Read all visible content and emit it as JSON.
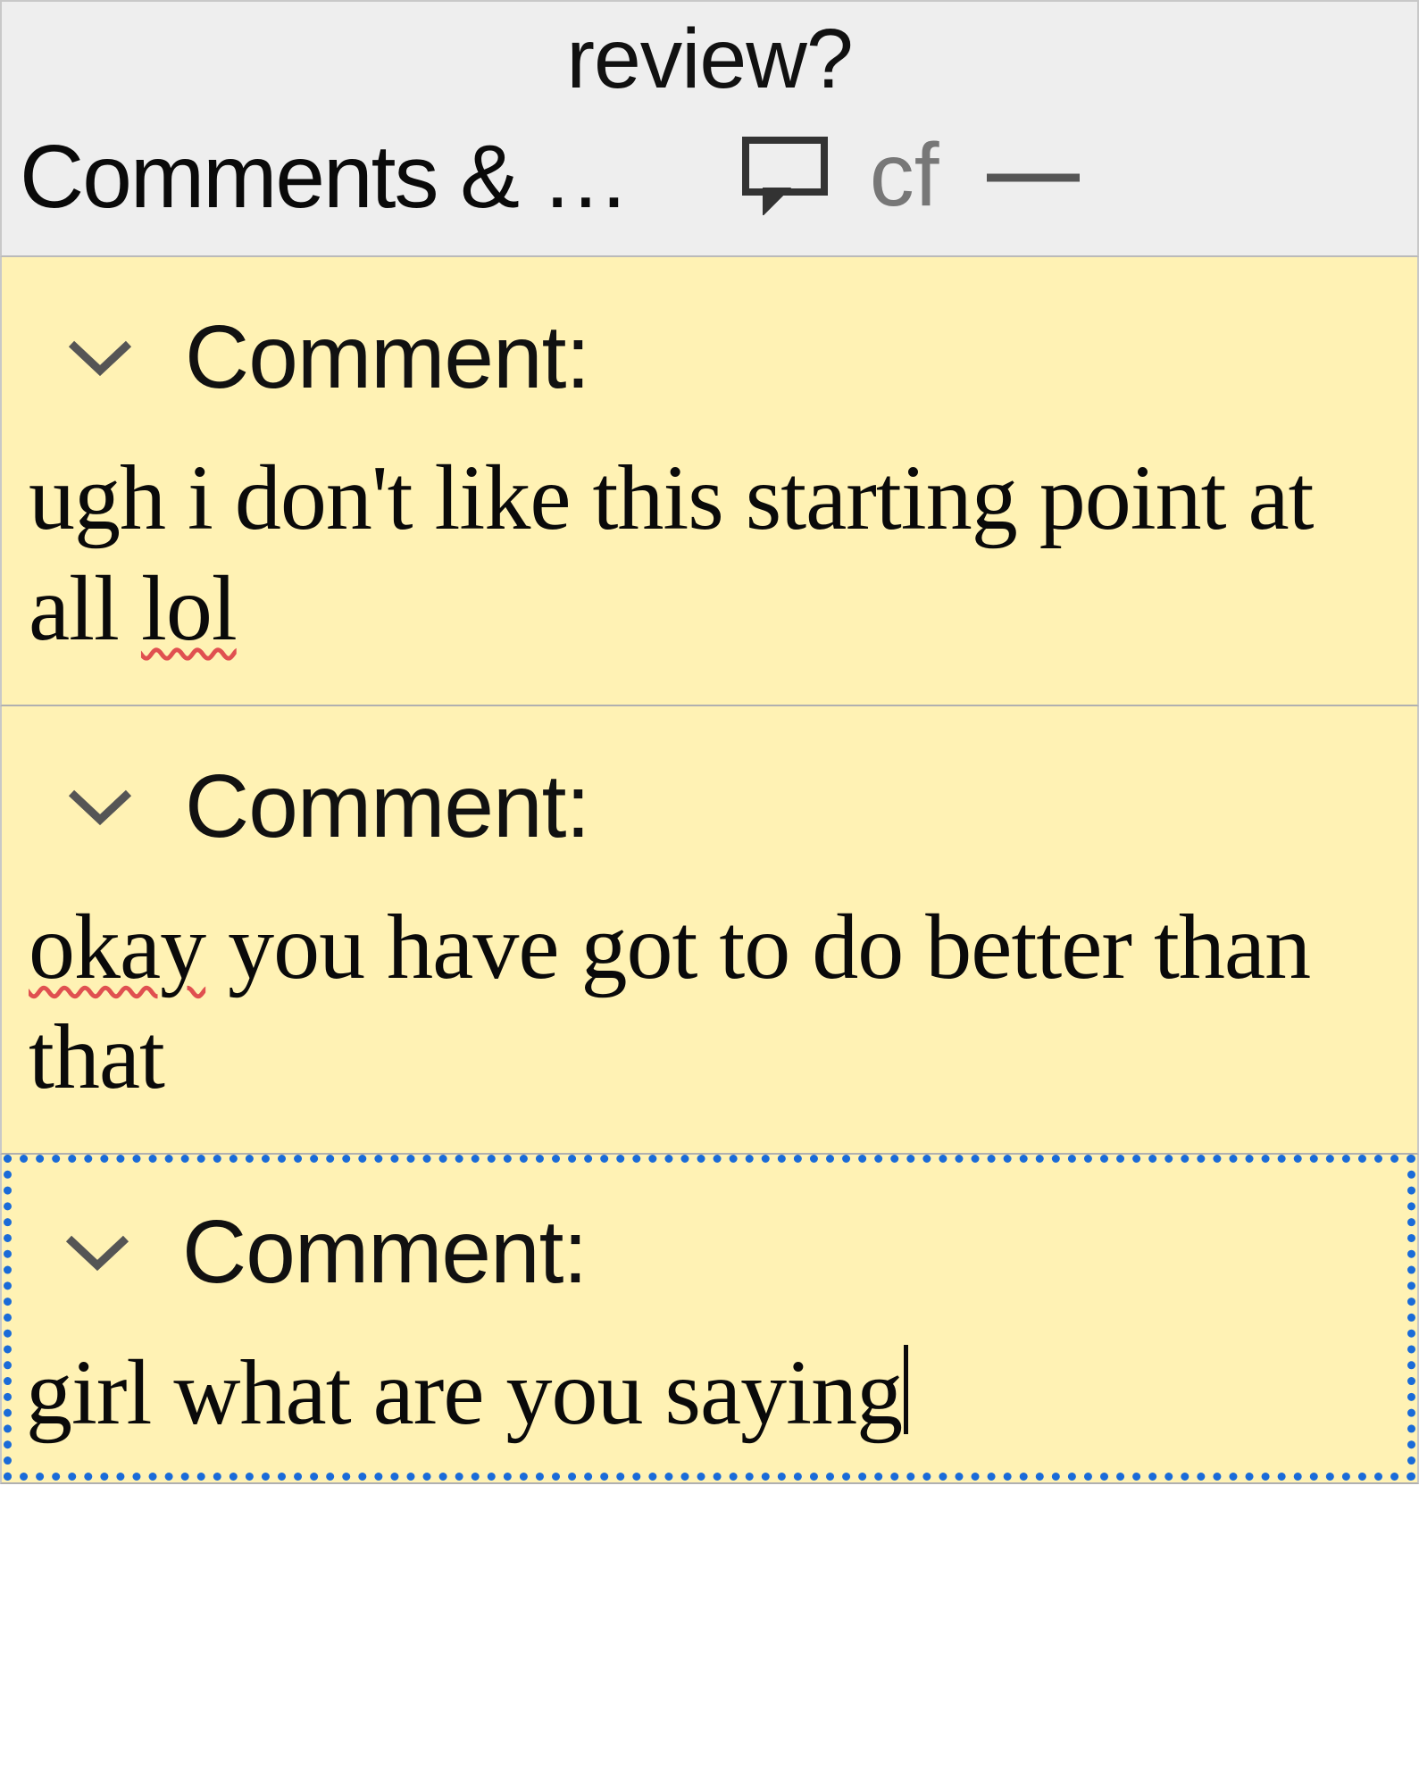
{
  "header": {
    "title": "review?"
  },
  "toolbar": {
    "panel_label": "Comments & …",
    "cf_label": "cf"
  },
  "comments": [
    {
      "label": "Comment:",
      "body_pre": "ugh i don't like this starting point at all ",
      "body_spell": "lol",
      "body_post": "",
      "selected": false
    },
    {
      "label": "Comment:",
      "body_pre": "",
      "body_spell": "okay",
      "body_post": " you have got to do better than that",
      "selected": false
    },
    {
      "label": "Comment:",
      "body_pre": "girl what are you saying",
      "body_spell": "",
      "body_post": "",
      "selected": true
    }
  ]
}
